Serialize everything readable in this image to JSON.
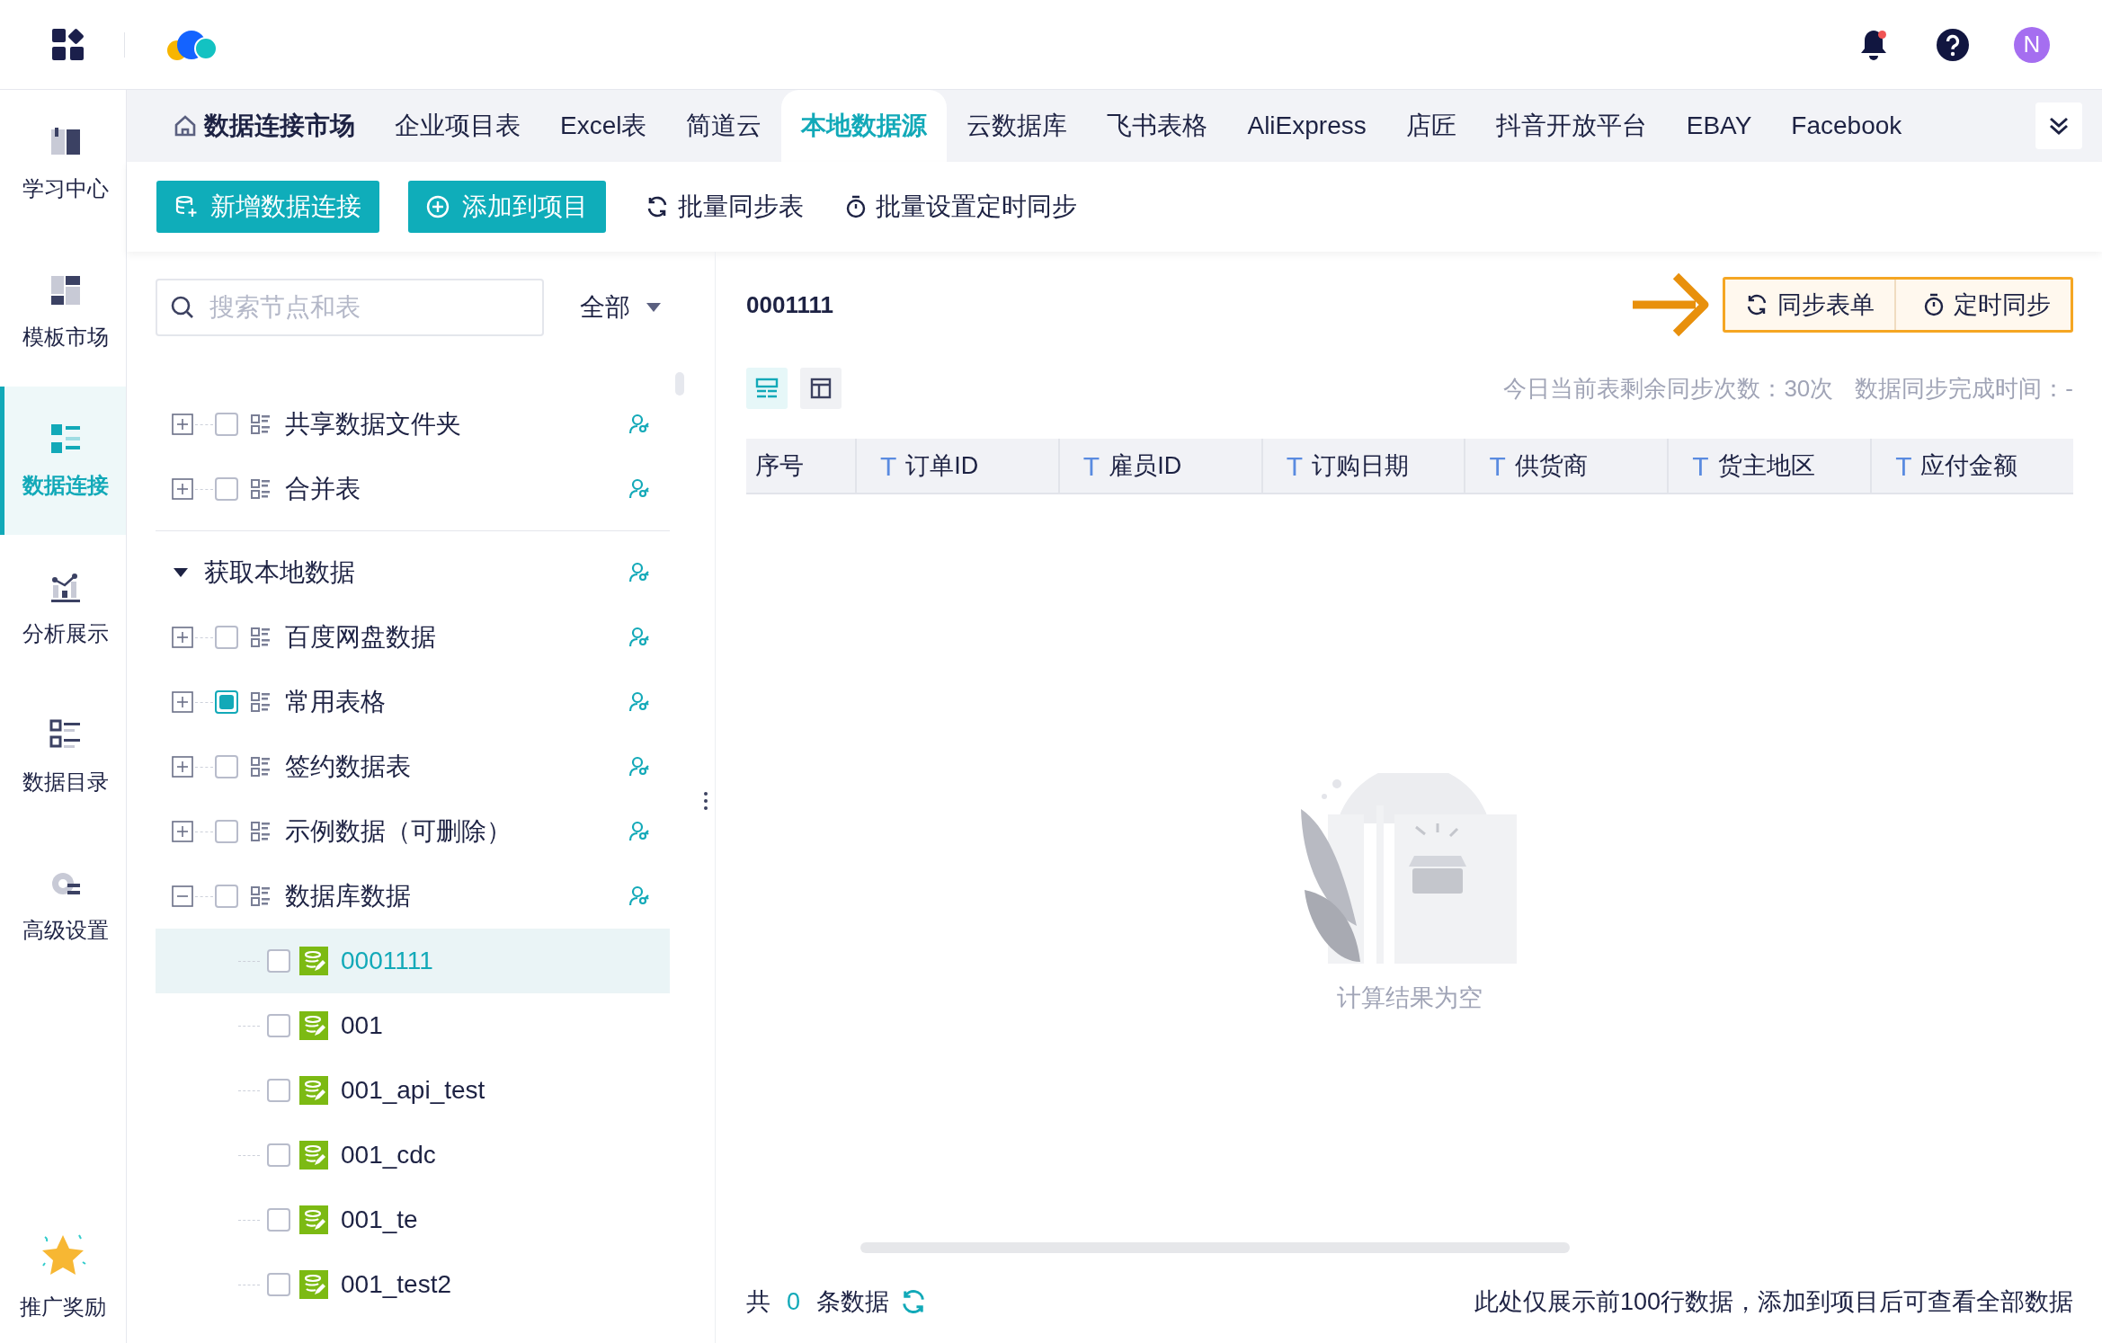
{
  "top_bar": {
    "avatar_initial": "N",
    "notification_unread": true
  },
  "nav": [
    {
      "label": "学习中心",
      "selected": false
    },
    {
      "label": "模板市场",
      "selected": false
    },
    {
      "label": "数据连接",
      "selected": true
    },
    {
      "label": "分析展示",
      "selected": false
    },
    {
      "label": "数据目录",
      "selected": false
    },
    {
      "label": "高级设置",
      "selected": false
    }
  ],
  "nav_bottom": {
    "label": "推广奖励"
  },
  "tabs": [
    {
      "label": "数据连接市场",
      "kind": "home",
      "selected": false
    },
    {
      "label": "企业项目表",
      "kind": "plain",
      "selected": false
    },
    {
      "label": "Excel表",
      "kind": "plain",
      "selected": false
    },
    {
      "label": "简道云",
      "kind": "plain",
      "selected": false
    },
    {
      "label": "本地数据源",
      "kind": "plain",
      "selected": true
    },
    {
      "label": "云数据库",
      "kind": "plain",
      "selected": false
    },
    {
      "label": "飞书表格",
      "kind": "plain",
      "selected": false
    },
    {
      "label": "AliExpress",
      "kind": "plain",
      "selected": false
    },
    {
      "label": "店匠",
      "kind": "plain",
      "selected": false
    },
    {
      "label": "抖音开放平台",
      "kind": "plain",
      "selected": false
    },
    {
      "label": "EBAY",
      "kind": "plain",
      "selected": false
    },
    {
      "label": "Facebook",
      "kind": "plain",
      "selected": false
    }
  ],
  "toolbar": [
    {
      "label": "新增数据连接",
      "kind": "primary"
    },
    {
      "label": "添加到项目",
      "kind": "primary"
    },
    {
      "label": "批量同步表",
      "kind": "link"
    },
    {
      "label": "批量设置定时同步",
      "kind": "link"
    }
  ],
  "tree": {
    "search": {
      "placeholder": "搜索节点和表"
    },
    "filter": "全部",
    "top_items": [
      {
        "label": "共享数据文件夹",
        "checked": false,
        "expanded": false
      },
      {
        "label": "合并表",
        "checked": false,
        "expanded": false
      }
    ],
    "group": {
      "label": "获取本地数据",
      "expanded": true,
      "children": [
        {
          "label": "百度网盘数据",
          "checked": false,
          "expanded": false
        },
        {
          "label": "常用表格",
          "checked": true,
          "expanded": false
        },
        {
          "label": "签约数据表",
          "checked": false,
          "expanded": false
        },
        {
          "label": "示例数据（可删除）",
          "checked": false,
          "expanded": false
        },
        {
          "label": "数据库数据",
          "checked": false,
          "expanded": true,
          "children": [
            {
              "label": "0001111",
              "checked": false,
              "selected": true
            },
            {
              "label": "001",
              "checked": false,
              "selected": false
            },
            {
              "label": "001_api_test",
              "checked": false,
              "selected": false
            },
            {
              "label": "001_cdc",
              "checked": false,
              "selected": false
            },
            {
              "label": "001_te",
              "checked": false,
              "selected": false
            },
            {
              "label": "001_test2",
              "checked": false,
              "selected": false
            }
          ]
        }
      ]
    }
  },
  "detail": {
    "title": "0001111",
    "callout": true,
    "actions": [
      {
        "label": "同步表单"
      },
      {
        "label": "定时同步"
      }
    ],
    "views": [
      {
        "selected": true
      },
      {
        "selected": false
      }
    ],
    "stats": [
      "今日当前表剩余同步次数：30次",
      "数据同步完成时间：-"
    ],
    "columns": [
      {
        "label": "序号",
        "kind": "index"
      },
      {
        "label": "订单ID",
        "kind": "text",
        "type_mark": "T"
      },
      {
        "label": "雇员ID",
        "kind": "text",
        "type_mark": "T"
      },
      {
        "label": "订购日期",
        "kind": "text",
        "type_mark": "T"
      },
      {
        "label": "供货商",
        "kind": "text",
        "type_mark": "T"
      },
      {
        "label": "货主地区",
        "kind": "text",
        "type_mark": "T"
      },
      {
        "label": "应付金额",
        "kind": "text",
        "type_mark": "T"
      }
    ],
    "empty_text": "计算结果为空",
    "footer": {
      "prefix": "共",
      "count": "0",
      "suffix": "条数据",
      "note": "此处仅展示前100行数据，添加到项目后可查看全部数据"
    }
  }
}
